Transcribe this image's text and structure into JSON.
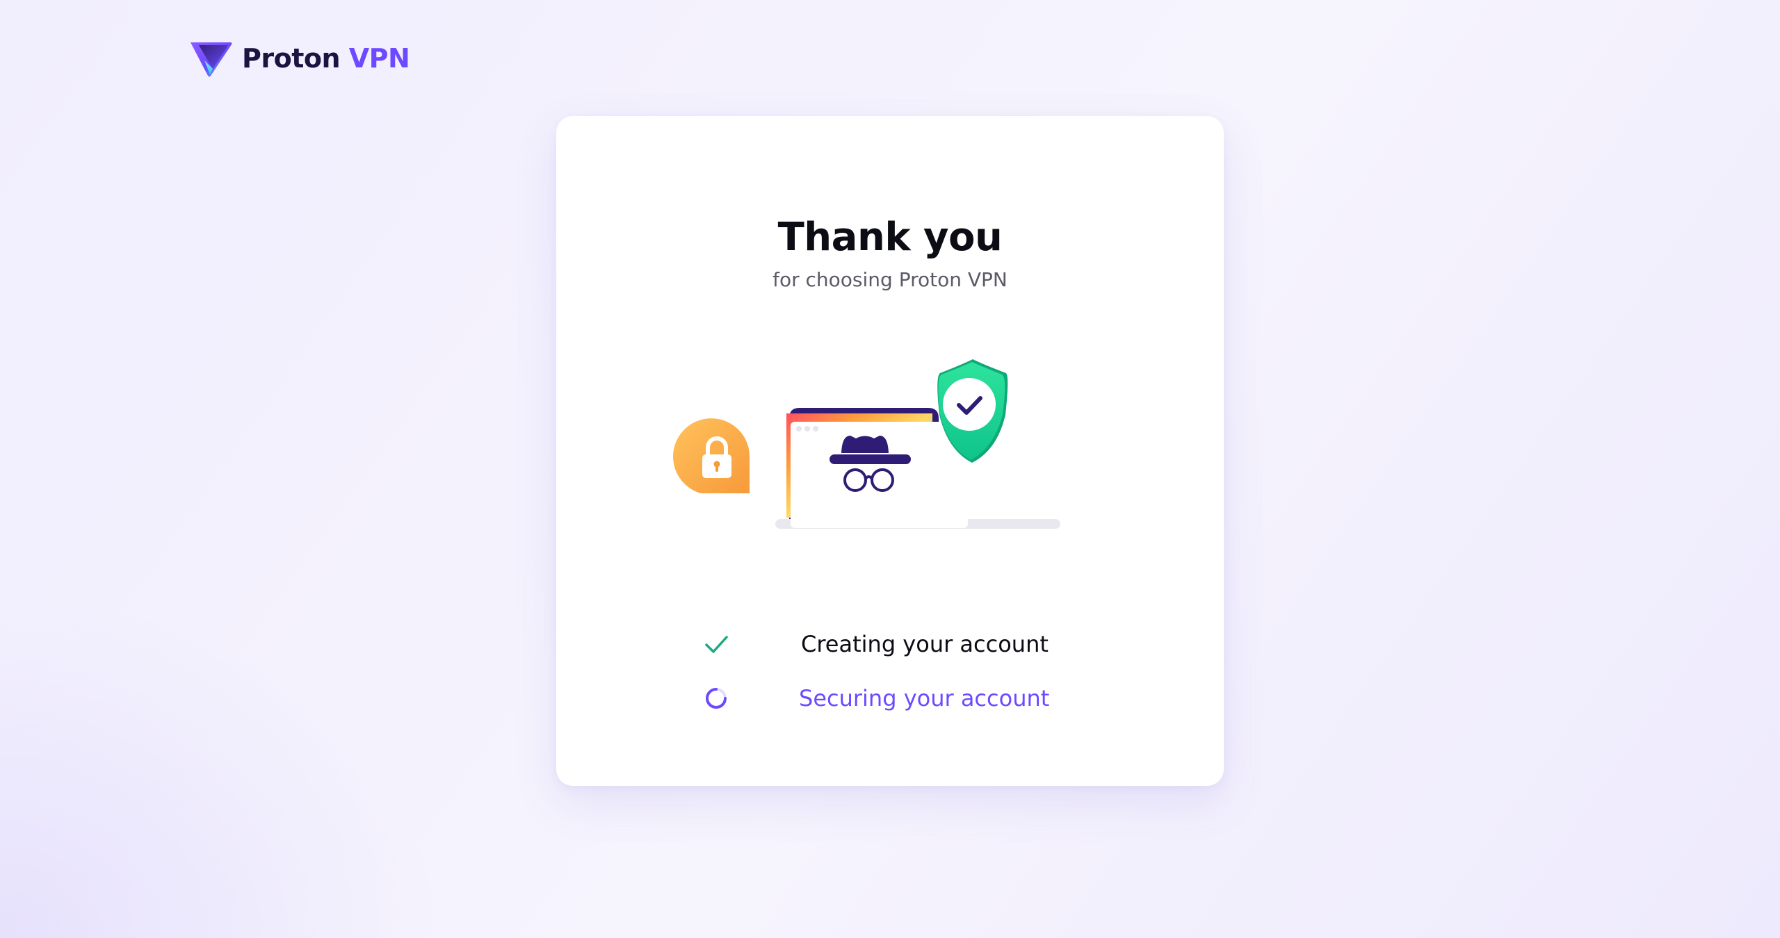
{
  "brand": {
    "name_part1": "Proton",
    "name_part2": "VPN",
    "logo_icon": "proton-vpn-logo-icon",
    "accent_color": "#6d4aff"
  },
  "card": {
    "title": "Thank you",
    "subtitle": "for choosing Proton VPN"
  },
  "illustration": {
    "icons": [
      "lock-badge-icon",
      "laptop-incognito-icon",
      "shield-check-icon"
    ]
  },
  "steps": [
    {
      "label": "Creating your account",
      "status": "done",
      "icon": "check-icon",
      "color": "#1ea884"
    },
    {
      "label": "Securing your account",
      "status": "in-progress",
      "icon": "spinner-icon",
      "color": "#6d4aff"
    }
  ]
}
